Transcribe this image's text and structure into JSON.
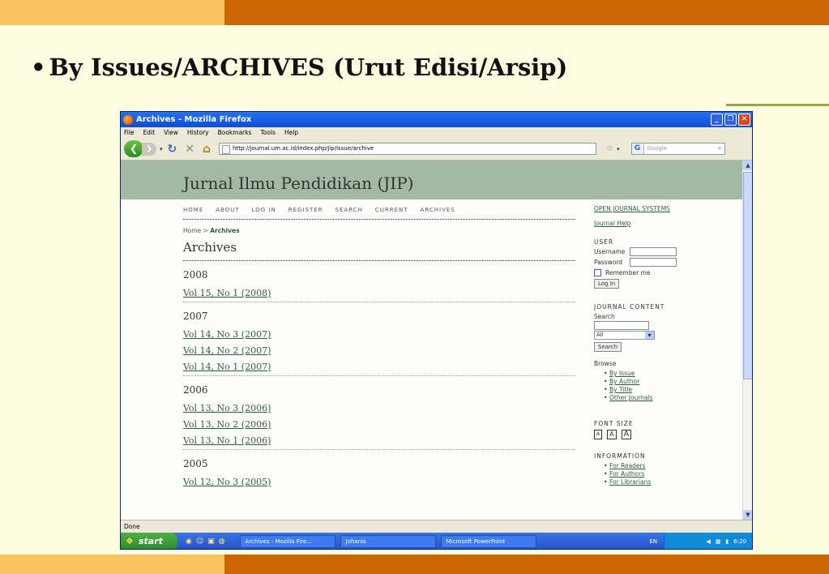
{
  "slide": {
    "bullet": "•",
    "title": "By Issues/ARCHIVES (Urut Edisi/Arsip)"
  },
  "window": {
    "title": "Archives - Mozilla Firefox",
    "menu": [
      "File",
      "Edit",
      "View",
      "History",
      "Bookmarks",
      "Tools",
      "Help"
    ],
    "url": "http://journal.um.ac.id/index.php/jip/issue/archive",
    "search_placeholder": "Google",
    "status": "Done"
  },
  "site": {
    "title": "Jurnal Ilmu Pendidikan (JIP)",
    "nav": [
      "HOME",
      "ABOUT",
      "LOG IN",
      "REGISTER",
      "SEARCH",
      "CURRENT",
      "ARCHIVES"
    ],
    "breadcrumb_home": "Home",
    "breadcrumb_sep": ">",
    "breadcrumb_current": "Archives",
    "heading": "Archives",
    "years": [
      {
        "year": "2008",
        "issues": [
          "Vol 15, No 1 (2008)"
        ]
      },
      {
        "year": "2007",
        "issues": [
          "Vol 14, No 3 (2007)",
          "Vol 14, No 2 (2007)",
          "Vol 14, No 1 (2007)"
        ]
      },
      {
        "year": "2006",
        "issues": [
          "Vol 13, No 3 (2006)",
          "Vol 13, No 2 (2006)",
          "Vol 13, No 1 (2006)"
        ]
      },
      {
        "year": "2005",
        "issues": [
          "Vol 12, No 3 (2005)"
        ]
      }
    ]
  },
  "sidebar": {
    "ojs_link": "OPEN JOURNAL SYSTEMS",
    "help_link": "Journal Help",
    "user_heading": "USER",
    "username_label": "Username",
    "password_label": "Password",
    "remember_label": "Remember me",
    "login_button": "Log In",
    "content_heading": "JOURNAL CONTENT",
    "search_label": "Search",
    "search_scope": "All",
    "search_button": "Search",
    "browse_label": "Browse",
    "browse_links": [
      "By Issue",
      "By Author",
      "By Title",
      "Other Journals"
    ],
    "font_heading": "FONT SIZE",
    "font_buttons": [
      "A",
      "A",
      "A"
    ],
    "info_heading": "INFORMATION",
    "info_links": [
      "For Readers",
      "For Authors",
      "For Librarians"
    ]
  },
  "taskbar": {
    "start": "start",
    "tasks": [
      "Archives - Mozilla Fire...",
      "Johanis",
      "Microsoft PowerPoint"
    ],
    "lang": "EN",
    "clock": "6:20"
  },
  "colors": {
    "slide_bg": "#fdfbe0",
    "band_dark": "#cc6600",
    "band_light": "#fbc260",
    "site_header": "#a3b9a3",
    "link": "#2c5f3a"
  }
}
